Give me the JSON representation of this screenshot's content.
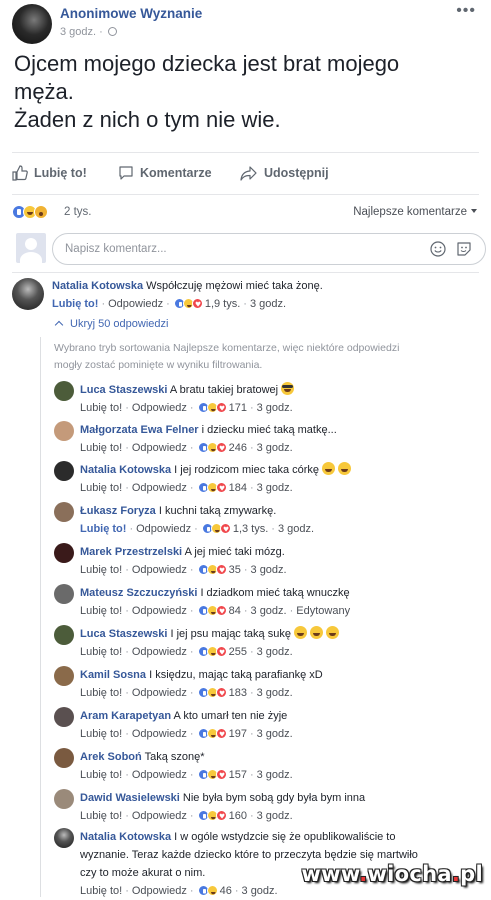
{
  "post": {
    "author": "Anonimowe Wyznanie",
    "time": "3 godz. ·",
    "more_icon": "more-dots-icon",
    "text_lines": [
      "Ojcem mojego dziecka jest brat mojego",
      "męża.",
      "Żaden z nich o tym nie wie."
    ]
  },
  "actions": {
    "like": "Lubię to!",
    "comment": "Komentarze",
    "share": "Udostępnij"
  },
  "summary": {
    "reactions": [
      "like",
      "haha",
      "wow"
    ],
    "count": "2 tys.",
    "sort_label": "Najlepsze komentarze"
  },
  "composer": {
    "placeholder": "Napisz komentarz..."
  },
  "top_comment": {
    "name": "Natalia Kotowska",
    "text": "Współczuję mężowi mieć taka żonę.",
    "like_label": "Lubię to!",
    "reply_label": "Odpowiedz",
    "reaction_count": "1,9 tys.",
    "time": "3 godz."
  },
  "hide_replies": "Ukryj 50 odpowiedzi",
  "filter_note_lines": [
    "Wybrano tryb sortowania Najlepsze komentarze, więc niektóre odpowiedzi",
    "mogły zostać pominięte w wyniku filtrowania."
  ],
  "replies": [
    {
      "name": "Luca Staszewski",
      "text": "A bratu takiej bratowej",
      "emojis": [
        "cool"
      ],
      "liked": false,
      "count": "171",
      "time": "3 godz.",
      "edited": ""
    },
    {
      "name": "Małgorzata Ewa Felner",
      "text": "i dziecku mieć taką matkę...",
      "emojis": [],
      "liked": false,
      "count": "246",
      "time": "3 godz.",
      "edited": ""
    },
    {
      "name": "Natalia Kotowska",
      "text": "I jej rodzicom miec taka córkę",
      "emojis": [
        "haha",
        "haha"
      ],
      "liked": false,
      "count": "184",
      "time": "3 godz.",
      "edited": ""
    },
    {
      "name": "Łukasz Foryza",
      "text": "I kuchni taką zmywarkę.",
      "emojis": [],
      "liked": true,
      "count": "1,3 tys.",
      "time": "3 godz.",
      "edited": ""
    },
    {
      "name": "Marek Przestrzelski",
      "text": "A jej mieć taki mózg.",
      "emojis": [],
      "liked": false,
      "count": "35",
      "time": "3 godz.",
      "edited": ""
    },
    {
      "name": "Mateusz Szczuczyński",
      "text": "I dziadkom mieć taką wnuczkę",
      "emojis": [],
      "liked": false,
      "count": "84",
      "time": "3 godz.",
      "edited": "Edytowany"
    },
    {
      "name": "Luca Staszewski",
      "text": "I jej psu mając taką sukę",
      "emojis": [
        "haha",
        "haha",
        "haha"
      ],
      "liked": false,
      "count": "255",
      "time": "3 godz.",
      "edited": ""
    },
    {
      "name": "Kamil Sosna",
      "text": "I księdzu, mając taką parafiankę xD",
      "emojis": [],
      "liked": false,
      "count": "183",
      "time": "3 godz.",
      "edited": ""
    },
    {
      "name": "Aram Karapetyan",
      "text": "A kto umarł ten nie żyje",
      "emojis": [],
      "liked": false,
      "count": "197",
      "time": "3 godz.",
      "edited": ""
    },
    {
      "name": "Arek Soboń",
      "text": "Taką szonę*",
      "emojis": [],
      "liked": false,
      "count": "157",
      "time": "3 godz.",
      "edited": ""
    },
    {
      "name": "Dawid Wasielewski",
      "text": "Nie była bym sobą gdy była bym inna",
      "emojis": [],
      "liked": false,
      "count": "160",
      "time": "3 godz.",
      "edited": ""
    }
  ],
  "last_reply": {
    "name": "Natalia Kotowska",
    "text_lines": [
      "I w ogóle wstydzcie się że opublikowaliście to",
      "wyznanie. Teraz każde dziecko które to przeczyta będzie się martwiło",
      "czy to może akurat o nim."
    ],
    "count": "46",
    "time": "3 godz."
  },
  "reply_labels": {
    "like": "Lubię to!",
    "reply": "Odpowiedz"
  },
  "watermark": {
    "prefix": "www",
    "dot1": ".",
    "middle": "wiocha",
    "dot2": ".",
    "suffix": "pl"
  },
  "colors": {
    "link_blue": "#365899",
    "like_blue": "#4267b2",
    "meta_gray": "#90949c"
  }
}
